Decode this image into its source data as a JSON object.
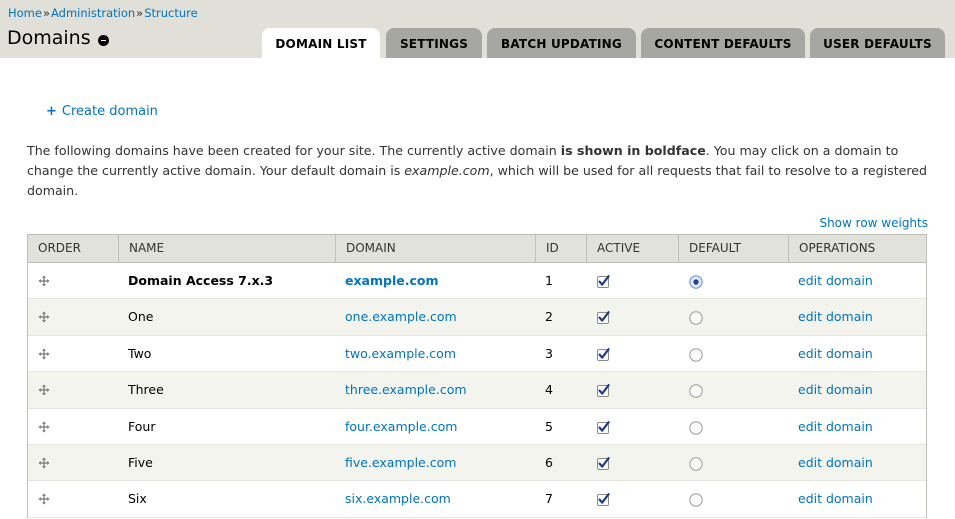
{
  "breadcrumb": {
    "items": [
      "Home",
      "Administration",
      "Structure"
    ],
    "separator": "»"
  },
  "page": {
    "title": "Domains"
  },
  "tabs": [
    {
      "label": "DOMAIN LIST",
      "active": true
    },
    {
      "label": "SETTINGS",
      "active": false
    },
    {
      "label": "BATCH UPDATING",
      "active": false
    },
    {
      "label": "CONTENT DEFAULTS",
      "active": false
    },
    {
      "label": "USER DEFAULTS",
      "active": false
    }
  ],
  "actions": {
    "create_domain": "Create domain"
  },
  "intro": {
    "part1": "The following domains have been created for your site. The currently active domain ",
    "bold": "is shown in boldface",
    "part2": ". You may click on a domain to change the currently active domain. Your default domain is ",
    "italic": "example.com",
    "part3": ", which will be used for all requests that fail to resolve to a registered domain."
  },
  "table": {
    "show_row_weights": "Show row weights",
    "columns": [
      "ORDER",
      "NAME",
      "DOMAIN",
      "ID",
      "ACTIVE",
      "DEFAULT",
      "OPERATIONS"
    ],
    "rows": [
      {
        "name": "Domain Access 7.x.3",
        "domain": "example.com",
        "id": "1",
        "active": true,
        "default": true,
        "operation": "edit domain",
        "current": true
      },
      {
        "name": "One",
        "domain": "one.example.com",
        "id": "2",
        "active": true,
        "default": false,
        "operation": "edit domain",
        "current": false
      },
      {
        "name": "Two",
        "domain": "two.example.com",
        "id": "3",
        "active": true,
        "default": false,
        "operation": "edit domain",
        "current": false
      },
      {
        "name": "Three",
        "domain": "three.example.com",
        "id": "4",
        "active": true,
        "default": false,
        "operation": "edit domain",
        "current": false
      },
      {
        "name": "Four",
        "domain": "four.example.com",
        "id": "5",
        "active": true,
        "default": false,
        "operation": "edit domain",
        "current": false
      },
      {
        "name": "Five",
        "domain": "five.example.com",
        "id": "6",
        "active": true,
        "default": false,
        "operation": "edit domain",
        "current": false
      },
      {
        "name": "Six",
        "domain": "six.example.com",
        "id": "7",
        "active": true,
        "default": false,
        "operation": "edit domain",
        "current": false
      }
    ]
  },
  "colors": {
    "link": "#0074bd",
    "header_bg": "#e0e0d8",
    "tab_inactive": "#a6a7a2",
    "row_even": "#f3f4ee",
    "table_head": "#e1e2dc"
  }
}
